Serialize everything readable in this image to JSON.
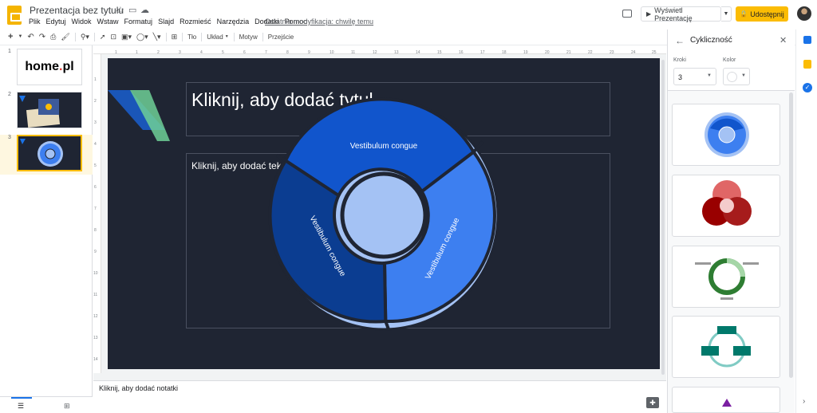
{
  "header": {
    "doc_title": "Prezentacja bez tytułu",
    "menu": [
      "Plik",
      "Edytuj",
      "Widok",
      "Wstaw",
      "Formatuj",
      "Slajd",
      "Rozmieść",
      "Narzędzia",
      "Dodatki",
      "Pomoc"
    ],
    "last_modified": "Ostatnia modyfikacja: chwilę temu",
    "present_label": "Wyświetl Prezentację",
    "share_label": "Udostępnij"
  },
  "toolbar": {
    "background_label": "Tło",
    "layout_label": "Układ",
    "theme_label": "Motyw",
    "transition_label": "Przejście"
  },
  "filmstrip": {
    "slides": [
      {
        "number": "1",
        "logo_text_a": "home",
        "logo_text_b": ".",
        "logo_text_c": "pl"
      },
      {
        "number": "2"
      },
      {
        "number": "3"
      }
    ]
  },
  "ruler": {
    "top": [
      "1",
      "1",
      "2",
      "3",
      "4",
      "5",
      "6",
      "7",
      "8",
      "9",
      "10",
      "11",
      "12",
      "13",
      "14",
      "15",
      "16",
      "17",
      "18",
      "19",
      "20",
      "21",
      "22",
      "23",
      "24",
      "25"
    ],
    "left": [
      "1",
      "2",
      "3",
      "4",
      "5",
      "6",
      "7",
      "8",
      "9",
      "10",
      "11",
      "12",
      "13",
      "14"
    ]
  },
  "slide": {
    "title_placeholder": "Kliknij, aby dodać tytuł",
    "body_placeholder": "Kliknij, aby dodać tekst",
    "diagram": {
      "segments": [
        "Vestibulum congue",
        "Vestibulum congue",
        "Vestibulum congue"
      ]
    }
  },
  "notes": {
    "placeholder": "Kliknij, aby dodać notatki"
  },
  "panel": {
    "title": "Cykliczność",
    "steps_label": "Kroki",
    "steps_value": "3",
    "color_label": "Kolor"
  },
  "colors": {
    "slide_bg": "#1f2533",
    "accent_yellow": "#fbbc04",
    "diagram_outer": "#a4c2f4",
    "diagram_top": "#1155cc",
    "diagram_left": "#0b3d91",
    "diagram_right": "#3d7ff0",
    "diagram_center": "#a4c2f4"
  }
}
